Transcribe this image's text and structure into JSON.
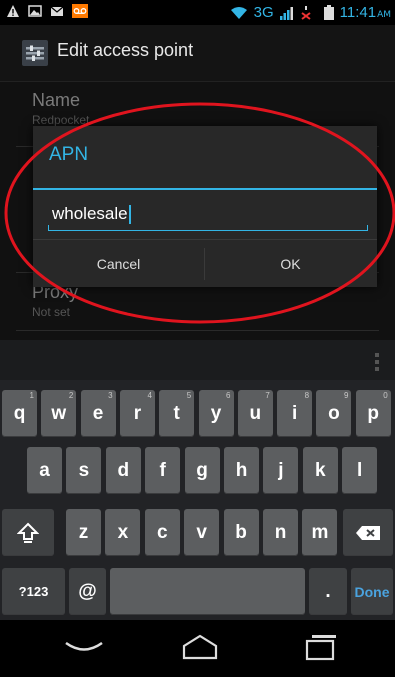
{
  "status_bar": {
    "network": "3G",
    "time": "11:41",
    "ampm": "AM"
  },
  "action_bar": {
    "title": "Edit access point"
  },
  "preferences": [
    {
      "title": "Name",
      "summary": "Redpocket"
    },
    {
      "title": "Proxy",
      "summary": "Not set"
    }
  ],
  "dialog": {
    "title": "APN",
    "input_value": "wholesale",
    "cancel_label": "Cancel",
    "ok_label": "OK"
  },
  "keyboard": {
    "row1": [
      {
        "label": "q",
        "hint": "1"
      },
      {
        "label": "w",
        "hint": "2"
      },
      {
        "label": "e",
        "hint": "3"
      },
      {
        "label": "r",
        "hint": "4"
      },
      {
        "label": "t",
        "hint": "5"
      },
      {
        "label": "y",
        "hint": "6"
      },
      {
        "label": "u",
        "hint": "7"
      },
      {
        "label": "i",
        "hint": "8"
      },
      {
        "label": "o",
        "hint": "9"
      },
      {
        "label": "p",
        "hint": "0"
      }
    ],
    "row2": [
      "a",
      "s",
      "d",
      "f",
      "g",
      "h",
      "j",
      "k",
      "l"
    ],
    "row3": [
      "z",
      "x",
      "c",
      "v",
      "b",
      "n",
      "m"
    ],
    "symbols_label": "?123",
    "at_label": "@",
    "period_label": ".",
    "done_label": "Done"
  },
  "colors": {
    "accent": "#33b5e5",
    "annotation": "#e0141e"
  }
}
